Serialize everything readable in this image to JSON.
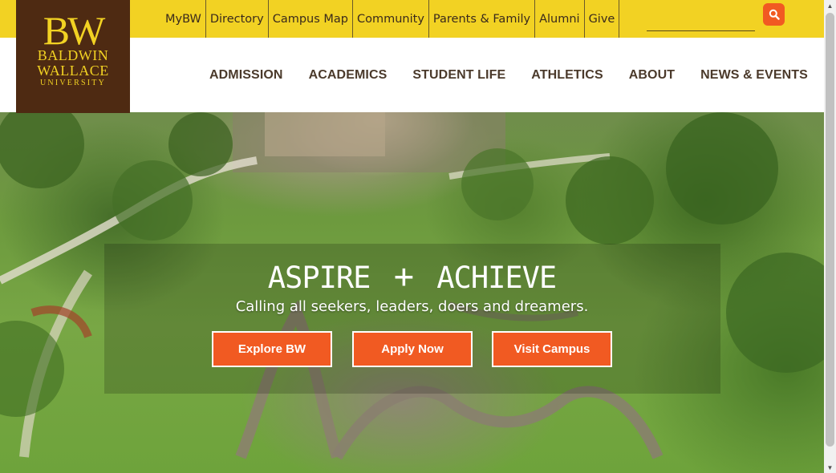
{
  "utility_nav": [
    "MyBW",
    "Directory",
    "Campus Map",
    "Community",
    "Parents & Family",
    "Alumni",
    "Give"
  ],
  "search": {
    "placeholder": "",
    "icon": "search-icon"
  },
  "logo": {
    "mark": "BW",
    "line1": "BALDWIN",
    "line2": "WALLACE",
    "line3": "UNIVERSITY"
  },
  "main_nav": [
    "ADMISSION",
    "ACADEMICS",
    "STUDENT LIFE",
    "ATHLETICS",
    "ABOUT",
    "NEWS & EVENTS"
  ],
  "hero": {
    "title_left": "ASPIRE",
    "title_plus": "+",
    "title_right": "ACHIEVE",
    "subtitle": "Calling all seekers, leaders, doers and dreamers.",
    "buttons": [
      "Explore BW",
      "Apply Now",
      "Visit Campus"
    ]
  },
  "colors": {
    "brand_gold": "#f2d223",
    "brand_brown": "#4e2a12",
    "accent_orange": "#f15a22",
    "nav_text": "#4b3a2b"
  }
}
